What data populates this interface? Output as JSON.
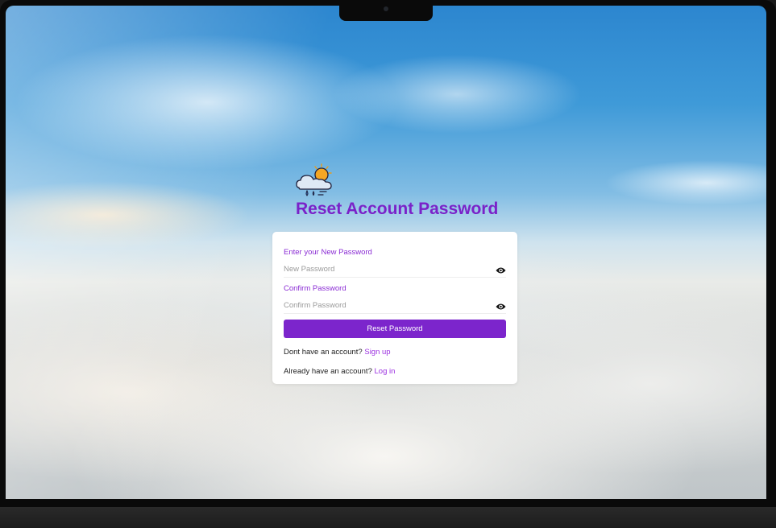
{
  "page": {
    "title": "Reset Account Password",
    "logo_icon": "weather-cloud-sun-rain-icon"
  },
  "form": {
    "new_password": {
      "label": "Enter your New Password",
      "placeholder": "New Password",
      "value": "",
      "toggle_icon": "eye-icon"
    },
    "confirm_password": {
      "label": "Confirm Password",
      "placeholder": "Confirm Password",
      "value": "",
      "toggle_icon": "eye-icon"
    },
    "submit_label": "Reset Password"
  },
  "footer": {
    "signup_prompt": "Dont have an account?",
    "signup_link": "Sign up",
    "login_prompt": "Already have an account?",
    "login_link": "Log in"
  },
  "colors": {
    "accent": "#7c25cc",
    "title": "#7a22c9",
    "label": "#8a2bd4",
    "link": "#9b30e0"
  }
}
